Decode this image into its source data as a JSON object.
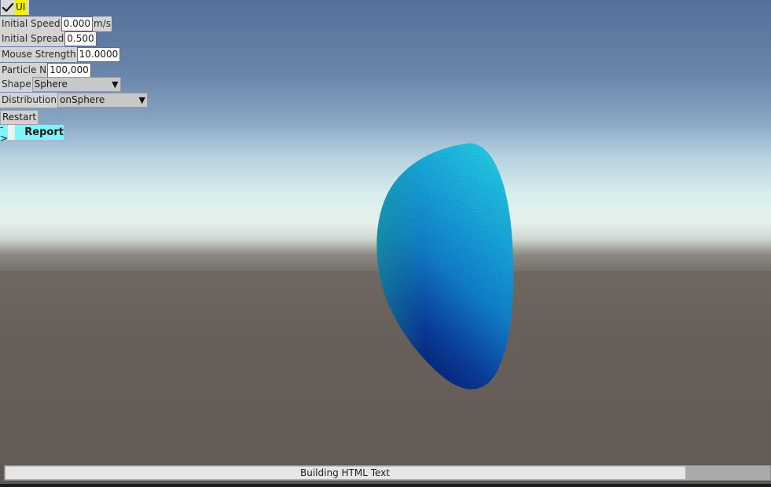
{
  "ui_toggle": {
    "checked": true,
    "label": "UI"
  },
  "params": {
    "initial_speed": {
      "label": "Initial Speed",
      "value": "0.000",
      "unit": "m/s"
    },
    "initial_spread": {
      "label": "Initial Spread",
      "value": "0.500"
    },
    "mouse_strength": {
      "label": "Mouse Strength",
      "value": "10.0000"
    },
    "particle_n": {
      "label": "Particle N",
      "value": "100,000"
    },
    "shape": {
      "label": "Shape",
      "selected": "Sphere"
    },
    "distribution": {
      "label": "Distribution",
      "selected": "onSphere"
    }
  },
  "buttons": {
    "restart": "Restart"
  },
  "report": {
    "arrow": "->",
    "label": "Report"
  },
  "status": {
    "text": "Building HTML Text",
    "progress": 0.89
  },
  "colors": {
    "ui_label_bg": "#f4f200",
    "report_bg": "#7ef5f8",
    "particle_light": "#1ed0e8",
    "particle_dark": "#08115e"
  },
  "icons": {
    "ui_check": "check-icon",
    "dropdown": "triangle-down-icon"
  }
}
